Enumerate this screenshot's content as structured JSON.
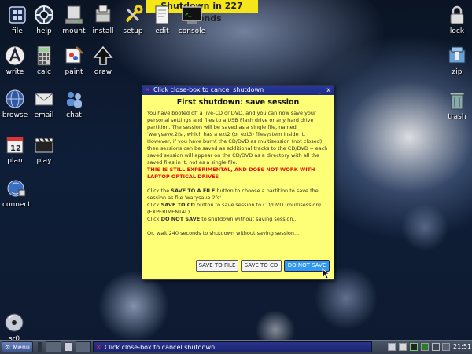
{
  "banner": {
    "text": "Shutdown in 227 seconds"
  },
  "desktop_icons": {
    "file": "file",
    "help": "help",
    "mount": "mount",
    "install": "install",
    "setup": "setup",
    "edit": "edit",
    "console": "console",
    "lock": "lock",
    "write": "write",
    "calc": "calc",
    "paint": "paint",
    "draw": "draw",
    "zip": "zip",
    "browse": "browse",
    "email": "email",
    "chat": "chat",
    "trash": "trash",
    "plan": "plan",
    "play": "play",
    "connect": "connect",
    "sr0": "sr0"
  },
  "dialog": {
    "title": "Click close-box to cancel shutdown",
    "heading": "First shutdown: save session",
    "para1": "You have booted off a live-CD or DVD, and you can now save your personal settings and files to a USB Flash drive or any hard drive partition. The session will be saved as a single file, named 'warysave.2fs', which has a ext2 (or ext3) filesystem inside it.",
    "para2": "However, if you have burnt the CD/DVD as multisession (not closed), then sessions can be saved as additional tracks to the CD/DVD -- each saved session will appear on the CD/DVD as a directory with all the saved files in it, not as a single file.",
    "warning": "THIS IS STILL EXPERIMENTAL, AND DOES NOT WORK WITH LAPTOP OPTICAL DRIVES",
    "line1_pre": "Click the ",
    "line1_bold": "SAVE TO A FILE",
    "line1_post": " button to choose a partition to save the session as file 'warysave.2fs'...",
    "line2_pre": "Click ",
    "line2_bold": "SAVE TO CD",
    "line2_post": " button to save session to CD/DVD (multisession) (EXPERIMENTAL)...",
    "line3_pre": "Click ",
    "line3_bold": "DO NOT SAVE",
    "line3_post": " to shutdown without saving session...",
    "line4": "Or, wait 240 seconds to shutdown without saving session...",
    "buttons": {
      "save_file": "SAVE TO FILE",
      "save_cd": "SAVE TO CD",
      "no_save": "DO NOT SAVE"
    },
    "minimize_glyph": "_",
    "close_glyph": "x"
  },
  "taskbar": {
    "menu_label": "Menu",
    "task_label": "Click close-box to cancel shutdown",
    "clock": "21:51"
  },
  "colors": {
    "dialog_bg": "#ffff77",
    "banner_bg": "#f5e61a",
    "warning": "#e01010",
    "titlebar": "#1c2a86",
    "active_button": "#3399ee"
  }
}
